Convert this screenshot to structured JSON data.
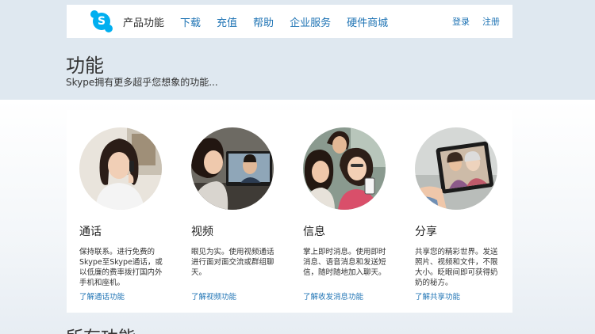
{
  "nav": {
    "logo_letter": "S",
    "links": [
      "产品功能",
      "下载",
      "充值",
      "帮助",
      "企业服务",
      "硬件商城"
    ],
    "login": "登录",
    "register": "注册"
  },
  "hero": {
    "title": "功能",
    "subtitle": "Skype拥有更多超乎您想象的功能..."
  },
  "features": [
    {
      "title": "通话",
      "desc": "保持联系。进行免费的Skype至Skype通话，或以低廉的费率拨打国内外手机和座机。",
      "link": "了解通话功能"
    },
    {
      "title": "视频",
      "desc": "眼见为实。使用视频通话进行面对面交流或群组聊天。",
      "link": "了解视频功能"
    },
    {
      "title": "信息",
      "desc": "掌上即时消息。使用即时消息、语音消息和发送短信，随时随地加入聊天。",
      "link": "了解收发消息功能"
    },
    {
      "title": "分享",
      "desc": "共享您的精彩世界。发送照片、视频和文件，不限大小。眨眼间即可获得奶奶的秘方。",
      "link": "了解共享功能"
    }
  ],
  "section_heading": "所有功能",
  "colors": {
    "brand": "#00aff0",
    "link": "#1e73b4",
    "band": "#dfe8f0"
  }
}
